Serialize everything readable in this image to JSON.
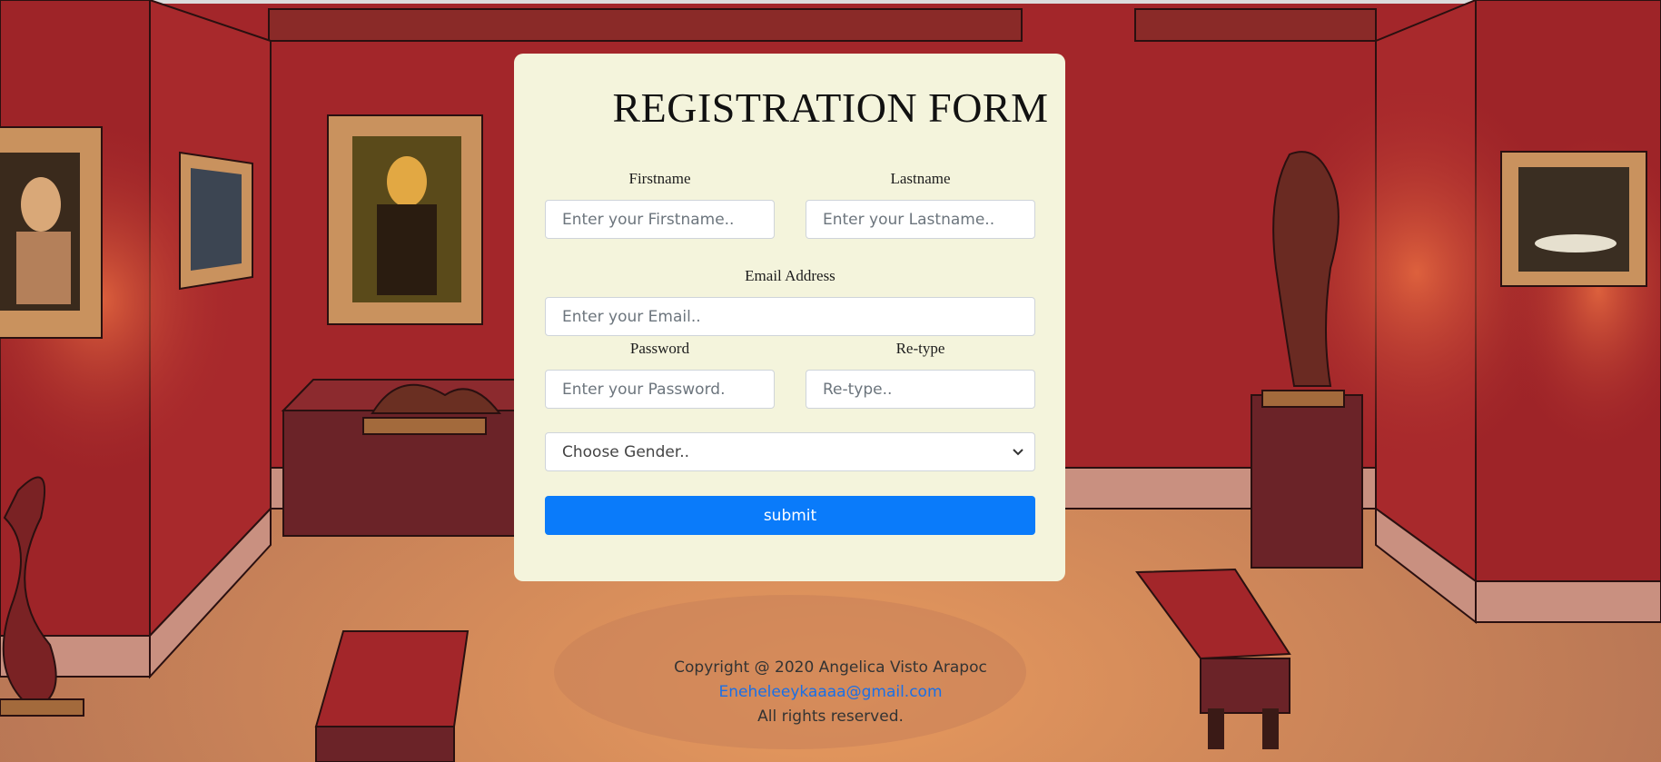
{
  "form": {
    "title": "REGISTRATION FORM",
    "firstname": {
      "label": "Firstname",
      "placeholder": "Enter your Firstname.."
    },
    "lastname": {
      "label": "Lastname",
      "placeholder": "Enter your Lastname.."
    },
    "email": {
      "label": "Email Address",
      "placeholder": "Enter your Email.."
    },
    "password": {
      "label": "Password",
      "placeholder": "Enter your Password."
    },
    "retype": {
      "label": "Re-type",
      "placeholder": "Re-type.."
    },
    "gender": {
      "selected": "Choose Gender.."
    },
    "submit_label": "submit"
  },
  "footer": {
    "copyright": "Copyright @ 2020 Angelica Visto Arapoc",
    "email": "Eneheleeykaaaa@gmail.com",
    "rights": "All rights reserved."
  },
  "background": {
    "wall_color": "#a3262a",
    "floor_color": "#c98a5c",
    "accent_button": "#0a7bfa"
  }
}
